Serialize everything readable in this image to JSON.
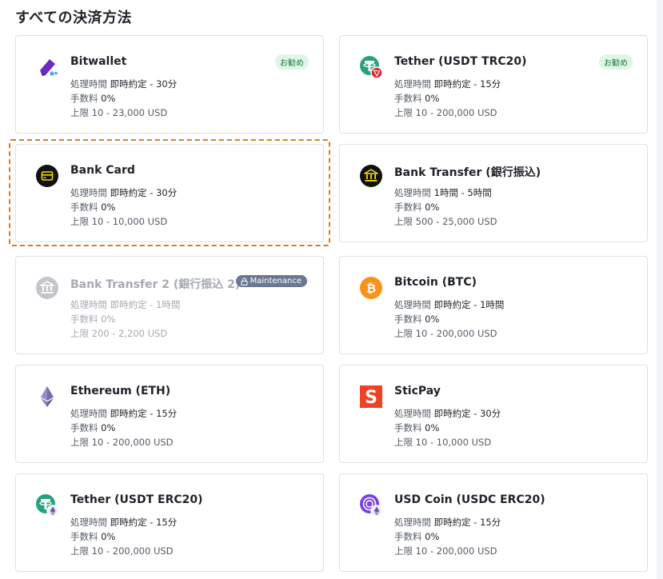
{
  "page_title": "すべての決済方法",
  "labels": {
    "time": "処理時間",
    "fee": "手数料",
    "limit": "上限"
  },
  "methods": [
    {
      "name": "Bitwallet",
      "icon": "bitwallet-icon",
      "time": "即時約定 - 30分",
      "fee": "0%",
      "limit": "10 - 23,000 USD",
      "badge": "お勧め"
    },
    {
      "name": "Tether (USDT TRC20)",
      "icon": "tether-trc20-icon",
      "time": "即時約定 - 15分",
      "fee": "0%",
      "limit": "10 - 200,000 USD",
      "badge": "お勧め"
    },
    {
      "name": "Bank Card",
      "icon": "bank-card-icon",
      "time": "即時約定 - 30分",
      "fee": "0%",
      "limit": "10 - 10,000 USD"
    },
    {
      "name": "Bank Transfer (銀行振込)",
      "icon": "bank-icon",
      "time": "1時間 - 5時間",
      "fee": "0%",
      "limit": "500 - 25,000 USD"
    },
    {
      "name": "Bank Transfer 2 (銀行振込 2)",
      "icon": "bank-icon",
      "time": "即時約定 - 1時間",
      "fee": "0%",
      "limit": "200 - 2,200 USD",
      "maintenance": "Maintenance"
    },
    {
      "name": "Bitcoin (BTC)",
      "icon": "bitcoin-icon",
      "time": "即時約定 - 1時間",
      "fee": "0%",
      "limit": "10 - 200,000 USD"
    },
    {
      "name": "Ethereum (ETH)",
      "icon": "ethereum-icon",
      "time": "即時約定 - 15分",
      "fee": "0%",
      "limit": "10 - 200,000 USD"
    },
    {
      "name": "SticPay",
      "icon": "sticpay-icon",
      "time": "即時約定 - 30分",
      "fee": "0%",
      "limit": "10 - 10,000 USD"
    },
    {
      "name": "Tether (USDT ERC20)",
      "icon": "tether-erc20-icon",
      "time": "即時約定 - 15分",
      "fee": "0%",
      "limit": "10 - 200,000 USD"
    },
    {
      "name": "USD Coin (USDC ERC20)",
      "icon": "usdc-erc20-icon",
      "time": "即時約定 - 15分",
      "fee": "0%",
      "limit": "10 - 200,000 USD"
    }
  ],
  "colors": {
    "accent_selected": "#e07a1f",
    "badge_bg": "#dff5e6",
    "badge_text": "#1a7a3c",
    "maintenance_bg": "#6b7895",
    "tether_green": "#26a17b",
    "tron_red": "#e5262b",
    "bitcoin_orange": "#f7931a",
    "sticpay_orange": "#ef4123",
    "bitwallet_purple": "#6a2bc4",
    "usdc_purple": "#7b3fe4"
  }
}
